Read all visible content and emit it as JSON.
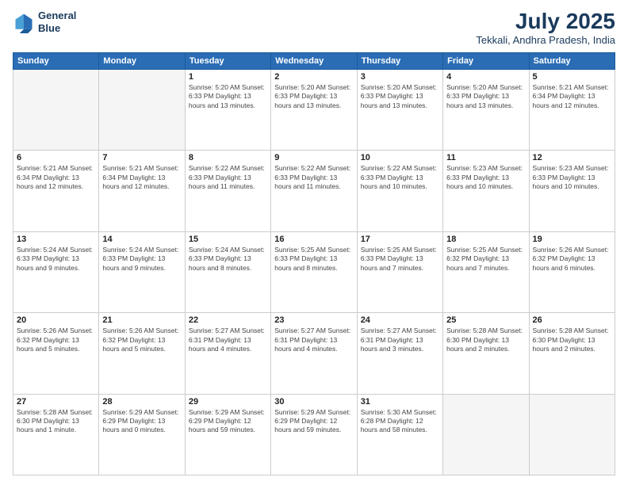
{
  "header": {
    "logo_line1": "General",
    "logo_line2": "Blue",
    "month_year": "July 2025",
    "location": "Tekkali, Andhra Pradesh, India"
  },
  "weekdays": [
    "Sunday",
    "Monday",
    "Tuesday",
    "Wednesday",
    "Thursday",
    "Friday",
    "Saturday"
  ],
  "weeks": [
    [
      {
        "day": "",
        "detail": ""
      },
      {
        "day": "",
        "detail": ""
      },
      {
        "day": "1",
        "detail": "Sunrise: 5:20 AM\nSunset: 6:33 PM\nDaylight: 13 hours\nand 13 minutes."
      },
      {
        "day": "2",
        "detail": "Sunrise: 5:20 AM\nSunset: 6:33 PM\nDaylight: 13 hours\nand 13 minutes."
      },
      {
        "day": "3",
        "detail": "Sunrise: 5:20 AM\nSunset: 6:33 PM\nDaylight: 13 hours\nand 13 minutes."
      },
      {
        "day": "4",
        "detail": "Sunrise: 5:20 AM\nSunset: 6:33 PM\nDaylight: 13 hours\nand 13 minutes."
      },
      {
        "day": "5",
        "detail": "Sunrise: 5:21 AM\nSunset: 6:34 PM\nDaylight: 13 hours\nand 12 minutes."
      }
    ],
    [
      {
        "day": "6",
        "detail": "Sunrise: 5:21 AM\nSunset: 6:34 PM\nDaylight: 13 hours\nand 12 minutes."
      },
      {
        "day": "7",
        "detail": "Sunrise: 5:21 AM\nSunset: 6:34 PM\nDaylight: 13 hours\nand 12 minutes."
      },
      {
        "day": "8",
        "detail": "Sunrise: 5:22 AM\nSunset: 6:33 PM\nDaylight: 13 hours\nand 11 minutes."
      },
      {
        "day": "9",
        "detail": "Sunrise: 5:22 AM\nSunset: 6:33 PM\nDaylight: 13 hours\nand 11 minutes."
      },
      {
        "day": "10",
        "detail": "Sunrise: 5:22 AM\nSunset: 6:33 PM\nDaylight: 13 hours\nand 10 minutes."
      },
      {
        "day": "11",
        "detail": "Sunrise: 5:23 AM\nSunset: 6:33 PM\nDaylight: 13 hours\nand 10 minutes."
      },
      {
        "day": "12",
        "detail": "Sunrise: 5:23 AM\nSunset: 6:33 PM\nDaylight: 13 hours\nand 10 minutes."
      }
    ],
    [
      {
        "day": "13",
        "detail": "Sunrise: 5:24 AM\nSunset: 6:33 PM\nDaylight: 13 hours\nand 9 minutes."
      },
      {
        "day": "14",
        "detail": "Sunrise: 5:24 AM\nSunset: 6:33 PM\nDaylight: 13 hours\nand 9 minutes."
      },
      {
        "day": "15",
        "detail": "Sunrise: 5:24 AM\nSunset: 6:33 PM\nDaylight: 13 hours\nand 8 minutes."
      },
      {
        "day": "16",
        "detail": "Sunrise: 5:25 AM\nSunset: 6:33 PM\nDaylight: 13 hours\nand 8 minutes."
      },
      {
        "day": "17",
        "detail": "Sunrise: 5:25 AM\nSunset: 6:33 PM\nDaylight: 13 hours\nand 7 minutes."
      },
      {
        "day": "18",
        "detail": "Sunrise: 5:25 AM\nSunset: 6:32 PM\nDaylight: 13 hours\nand 7 minutes."
      },
      {
        "day": "19",
        "detail": "Sunrise: 5:26 AM\nSunset: 6:32 PM\nDaylight: 13 hours\nand 6 minutes."
      }
    ],
    [
      {
        "day": "20",
        "detail": "Sunrise: 5:26 AM\nSunset: 6:32 PM\nDaylight: 13 hours\nand 5 minutes."
      },
      {
        "day": "21",
        "detail": "Sunrise: 5:26 AM\nSunset: 6:32 PM\nDaylight: 13 hours\nand 5 minutes."
      },
      {
        "day": "22",
        "detail": "Sunrise: 5:27 AM\nSunset: 6:31 PM\nDaylight: 13 hours\nand 4 minutes."
      },
      {
        "day": "23",
        "detail": "Sunrise: 5:27 AM\nSunset: 6:31 PM\nDaylight: 13 hours\nand 4 minutes."
      },
      {
        "day": "24",
        "detail": "Sunrise: 5:27 AM\nSunset: 6:31 PM\nDaylight: 13 hours\nand 3 minutes."
      },
      {
        "day": "25",
        "detail": "Sunrise: 5:28 AM\nSunset: 6:30 PM\nDaylight: 13 hours\nand 2 minutes."
      },
      {
        "day": "26",
        "detail": "Sunrise: 5:28 AM\nSunset: 6:30 PM\nDaylight: 13 hours\nand 2 minutes."
      }
    ],
    [
      {
        "day": "27",
        "detail": "Sunrise: 5:28 AM\nSunset: 6:30 PM\nDaylight: 13 hours\nand 1 minute."
      },
      {
        "day": "28",
        "detail": "Sunrise: 5:29 AM\nSunset: 6:29 PM\nDaylight: 13 hours\nand 0 minutes."
      },
      {
        "day": "29",
        "detail": "Sunrise: 5:29 AM\nSunset: 6:29 PM\nDaylight: 12 hours\nand 59 minutes."
      },
      {
        "day": "30",
        "detail": "Sunrise: 5:29 AM\nSunset: 6:29 PM\nDaylight: 12 hours\nand 59 minutes."
      },
      {
        "day": "31",
        "detail": "Sunrise: 5:30 AM\nSunset: 6:28 PM\nDaylight: 12 hours\nand 58 minutes."
      },
      {
        "day": "",
        "detail": ""
      },
      {
        "day": "",
        "detail": ""
      }
    ]
  ]
}
